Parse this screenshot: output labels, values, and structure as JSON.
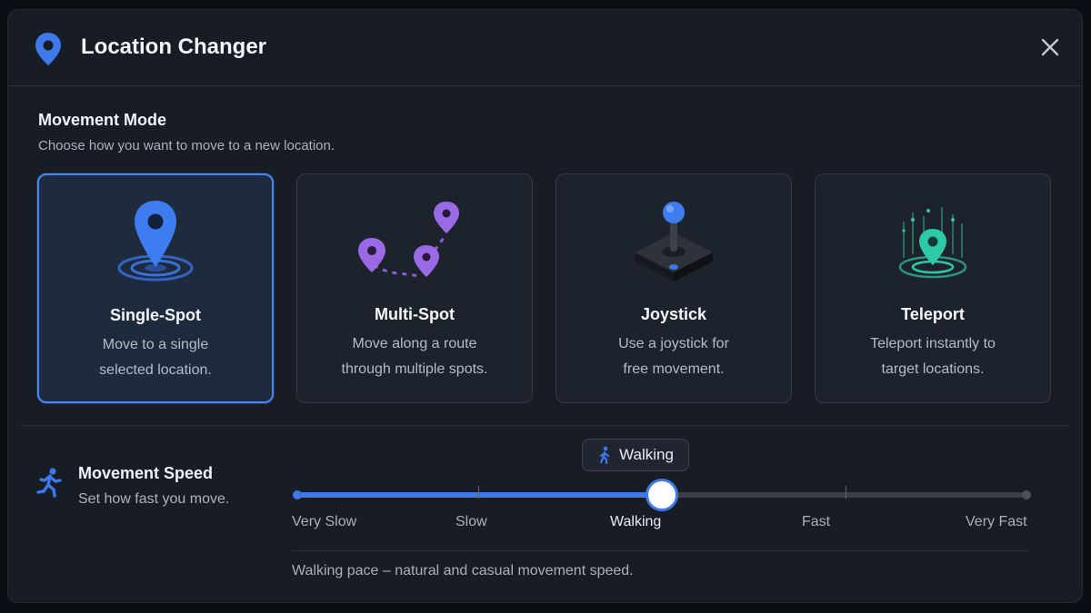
{
  "header": {
    "title": "Location Changer",
    "icon": "map-pin-icon",
    "close_icon": "close-icon"
  },
  "movement_mode": {
    "title": "Movement Mode",
    "subtitle": "Choose how you want to move to a new location.",
    "selected": "Single-Spot",
    "cards": [
      {
        "name": "Single-Spot",
        "desc_line1": "Move to a single",
        "desc_line2": "selected location.",
        "icon": "pin-target-icon",
        "color": "#3e78ea"
      },
      {
        "name": "Multi-Spot",
        "desc_line1": "Move along a route",
        "desc_line2": "through multiple spots.",
        "icon": "route-pins-icon",
        "color": "#9a6ae6"
      },
      {
        "name": "Joystick",
        "desc_line1": "Use a joystick for",
        "desc_line2": "free movement.",
        "icon": "joystick-icon",
        "color": "#3e78ea"
      },
      {
        "name": "Teleport",
        "desc_line1": "Teleport instantly to",
        "desc_line2": "target locations.",
        "icon": "teleport-pin-icon",
        "color": "#2ec9a8"
      }
    ]
  },
  "movement_speed": {
    "title": "Movement Speed",
    "subtitle": "Set how fast you move.",
    "icon": "running-person-icon",
    "current": "Walking",
    "current_level": 0.5,
    "levels": [
      "Very Slow",
      "Slow",
      "Walking",
      "Fast",
      "Very Fast"
    ],
    "note": "Walking pace – natural and casual movement speed.",
    "accent": "#3e78ea"
  }
}
